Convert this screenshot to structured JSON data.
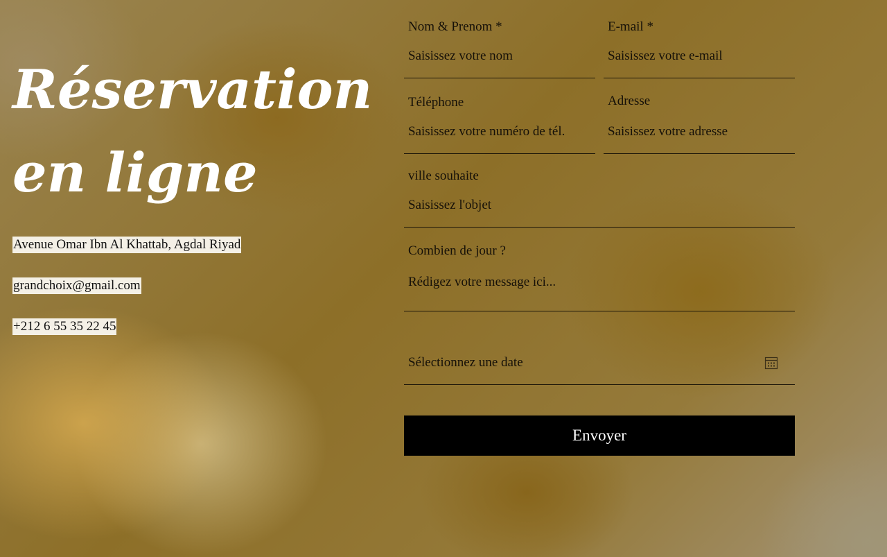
{
  "hero": {
    "title_line1": "Réservation",
    "title_line2": "en ligne"
  },
  "contact": {
    "address": "Avenue Omar Ibn Al Khattab, Agdal Riyad",
    "email": "grandchoix@gmail.com",
    "phone": "+212 6 55 35 22 45"
  },
  "form": {
    "name": {
      "label": "Nom & Prenom *",
      "placeholder": "Saisissez votre nom"
    },
    "email": {
      "label": "E-mail *",
      "placeholder": "Saisissez votre e-mail"
    },
    "phone": {
      "label": "Téléphone",
      "placeholder": "Saisissez votre numéro de tél."
    },
    "address": {
      "label": "Adresse",
      "placeholder": "Saisissez votre adresse"
    },
    "city": {
      "label": "ville souhaite",
      "placeholder": "Saisissez l'objet"
    },
    "days": {
      "label": "Combien de jour ?",
      "placeholder": "Rédigez votre message ici..."
    },
    "date": {
      "placeholder": "Sélectionnez une date",
      "icon": "calendar-icon"
    },
    "submit_label": "Envoyer"
  },
  "colors": {
    "title": "#ffffff",
    "button_bg": "#000000",
    "button_text": "#ffffff",
    "contact_highlight": "#f4f0e6"
  }
}
